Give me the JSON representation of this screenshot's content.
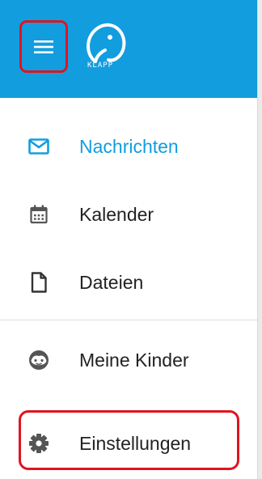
{
  "app": {
    "logo_text": "KLAPP",
    "header_color": "#129ddf"
  },
  "header": {
    "menu_icon": "hamburger-menu-icon",
    "logo_icon": "klapp-logo"
  },
  "nav": {
    "items": [
      {
        "label": "Nachrichten",
        "icon": "envelope-icon",
        "active": true
      },
      {
        "label": "Kalender",
        "icon": "calendar-icon",
        "active": false
      },
      {
        "label": "Dateien",
        "icon": "file-icon",
        "active": false
      },
      {
        "label": "Meine Kinder",
        "icon": "child-face-icon",
        "active": false
      },
      {
        "label": "Einstellungen",
        "icon": "gear-icon",
        "active": false
      }
    ]
  },
  "colors": {
    "accent": "#129ddf",
    "highlight": "#e0141e",
    "text": "#222222",
    "icon": "#555555"
  }
}
